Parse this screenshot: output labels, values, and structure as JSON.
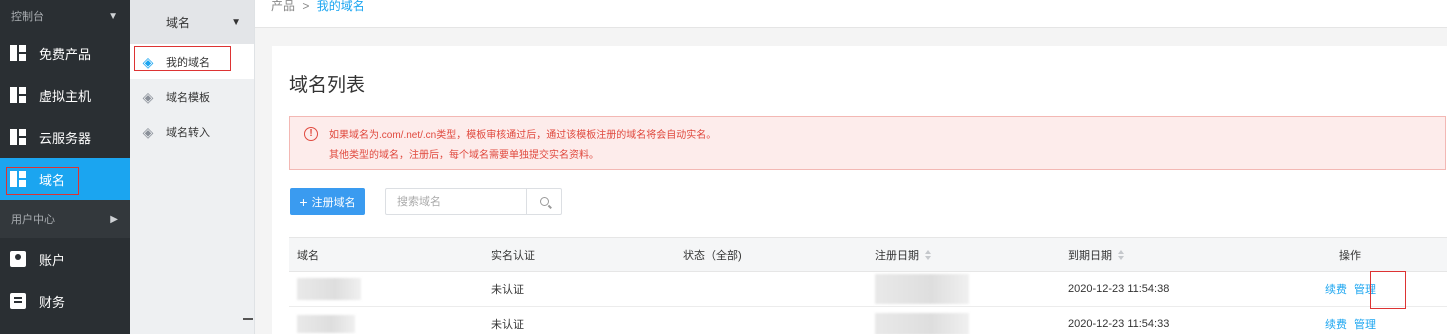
{
  "sidebar": {
    "console_label": "控制台",
    "user_center_label": "用户中心",
    "items_top": [
      {
        "label": "免费产品",
        "icon": "product-icon"
      },
      {
        "label": "虚拟主机",
        "icon": "host-icon"
      },
      {
        "label": "云服务器",
        "icon": "server-icon"
      },
      {
        "label": "域名",
        "icon": "domain-icon",
        "active": true
      }
    ],
    "items_bottom": [
      {
        "label": "账户",
        "icon": "account-icon"
      },
      {
        "label": "财务",
        "icon": "finance-icon"
      }
    ],
    "active_color": "#1ba5f0"
  },
  "subnav": {
    "header": "域名",
    "items": [
      {
        "label": "我的域名",
        "selected": true
      },
      {
        "label": "域名模板"
      },
      {
        "label": "域名转入"
      }
    ]
  },
  "breadcrumb": {
    "root": "产品",
    "separator": ">",
    "current": "我的域名"
  },
  "main": {
    "title": "域名列表",
    "alert_line1": "如果域名为.com/.net/.cn类型，模板审核通过后，通过该模板注册的域名将会自动实名。",
    "alert_line2": "其他类型的域名，注册后，每个域名需要单独提交实名资料。",
    "register_button": "注册域名",
    "search_placeholder": "搜索域名"
  },
  "table": {
    "headers": {
      "domain": "域名",
      "verify": "实名认证",
      "status": "状态（全部)",
      "reg_date": "注册日期",
      "expire_date": "到期日期",
      "actions": "操作"
    },
    "rows": [
      {
        "verify": "未认证",
        "expire": "2020-12-23 11:54:38",
        "renew": "续费",
        "manage": "管理"
      },
      {
        "verify": "未认证",
        "expire": "2020-12-23 11:54:33",
        "renew": "续费",
        "manage": "管理"
      }
    ]
  }
}
